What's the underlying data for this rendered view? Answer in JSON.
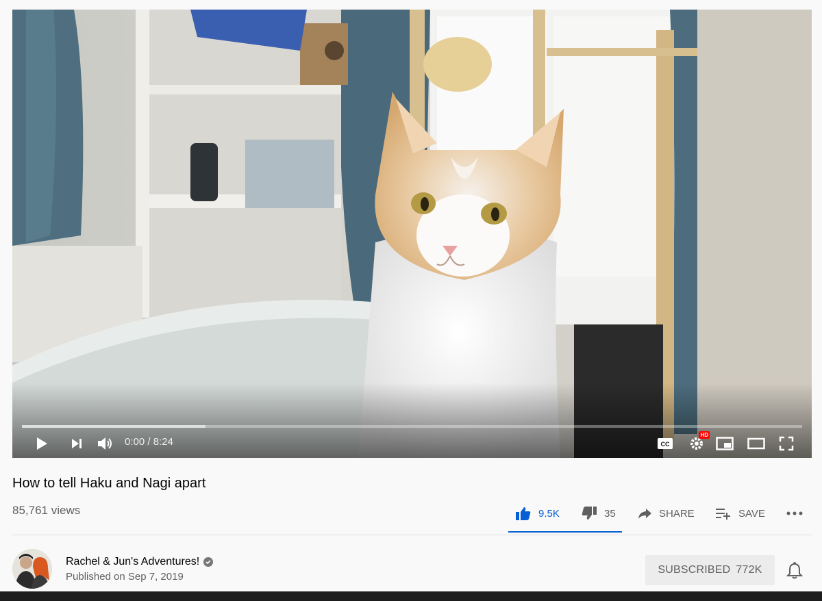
{
  "player": {
    "time_display": "0:00 / 8:24",
    "progress": {
      "played_fraction": 0.0,
      "buffered_fraction": 0.235
    },
    "controls": {
      "play_icon": "play-icon",
      "next_icon": "skip-next-icon",
      "volume_icon": "volume-icon",
      "cc_label": "CC",
      "settings_icon": "settings-gear-icon",
      "hd_badge": "HD",
      "miniplayer_icon": "miniplayer-icon",
      "theater_icon": "theater-mode-icon",
      "fullscreen_icon": "fullscreen-icon"
    }
  },
  "video": {
    "title": "How to tell Haku and Nagi apart",
    "views": "85,761 views"
  },
  "actions": {
    "like_count": "9.5K",
    "dislike_count": "35",
    "share_label": "SHARE",
    "save_label": "SAVE",
    "more_icon": "more-horizontal-icon"
  },
  "channel": {
    "name": "Rachel & Jun's Adventures!",
    "published": "Published on Sep 7, 2019",
    "subscribe_label": "SUBSCRIBED",
    "subscriber_count": "772K"
  },
  "colors": {
    "accent_blue": "#065fd4",
    "progress_red": "#ff0000",
    "text_secondary": "#606060",
    "subscribed_bg": "#ececec"
  }
}
